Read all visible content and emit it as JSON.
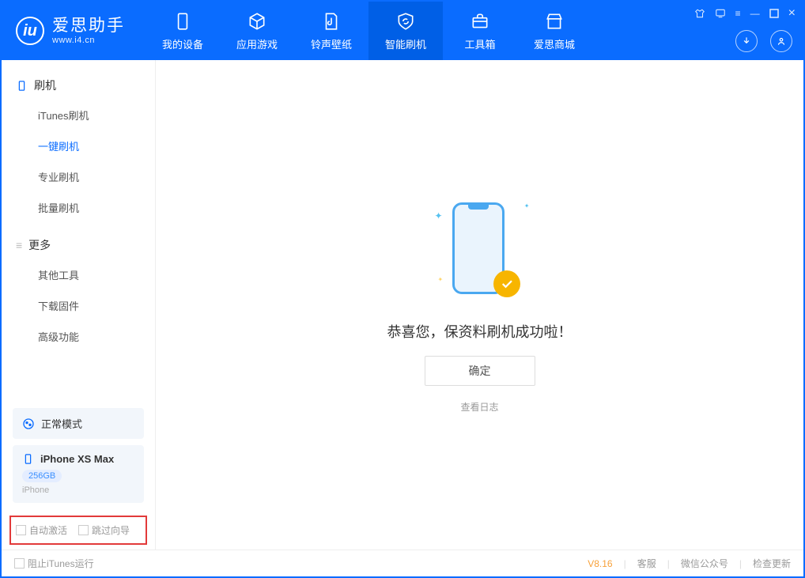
{
  "app": {
    "name": "爱思助手",
    "url": "www.i4.cn"
  },
  "nav": {
    "tabs": [
      {
        "label": "我的设备"
      },
      {
        "label": "应用游戏"
      },
      {
        "label": "铃声壁纸"
      },
      {
        "label": "智能刷机"
      },
      {
        "label": "工具箱"
      },
      {
        "label": "爱思商城"
      }
    ]
  },
  "sidebar": {
    "sections": [
      {
        "title": "刷机",
        "items": [
          "iTunes刷机",
          "一键刷机",
          "专业刷机",
          "批量刷机"
        ]
      },
      {
        "title": "更多",
        "items": [
          "其他工具",
          "下载固件",
          "高级功能"
        ]
      }
    ],
    "mode": "正常模式",
    "device": {
      "name": "iPhone XS Max",
      "storage": "256GB",
      "type": "iPhone"
    },
    "options": {
      "auto_activate": "自动激活",
      "skip_guide": "跳过向导"
    }
  },
  "main": {
    "success_message": "恭喜您，保资料刷机成功啦！",
    "ok_button": "确定",
    "view_log": "查看日志"
  },
  "footer": {
    "block_itunes": "阻止iTunes运行",
    "version": "V8.16",
    "links": [
      "客服",
      "微信公众号",
      "检查更新"
    ]
  }
}
